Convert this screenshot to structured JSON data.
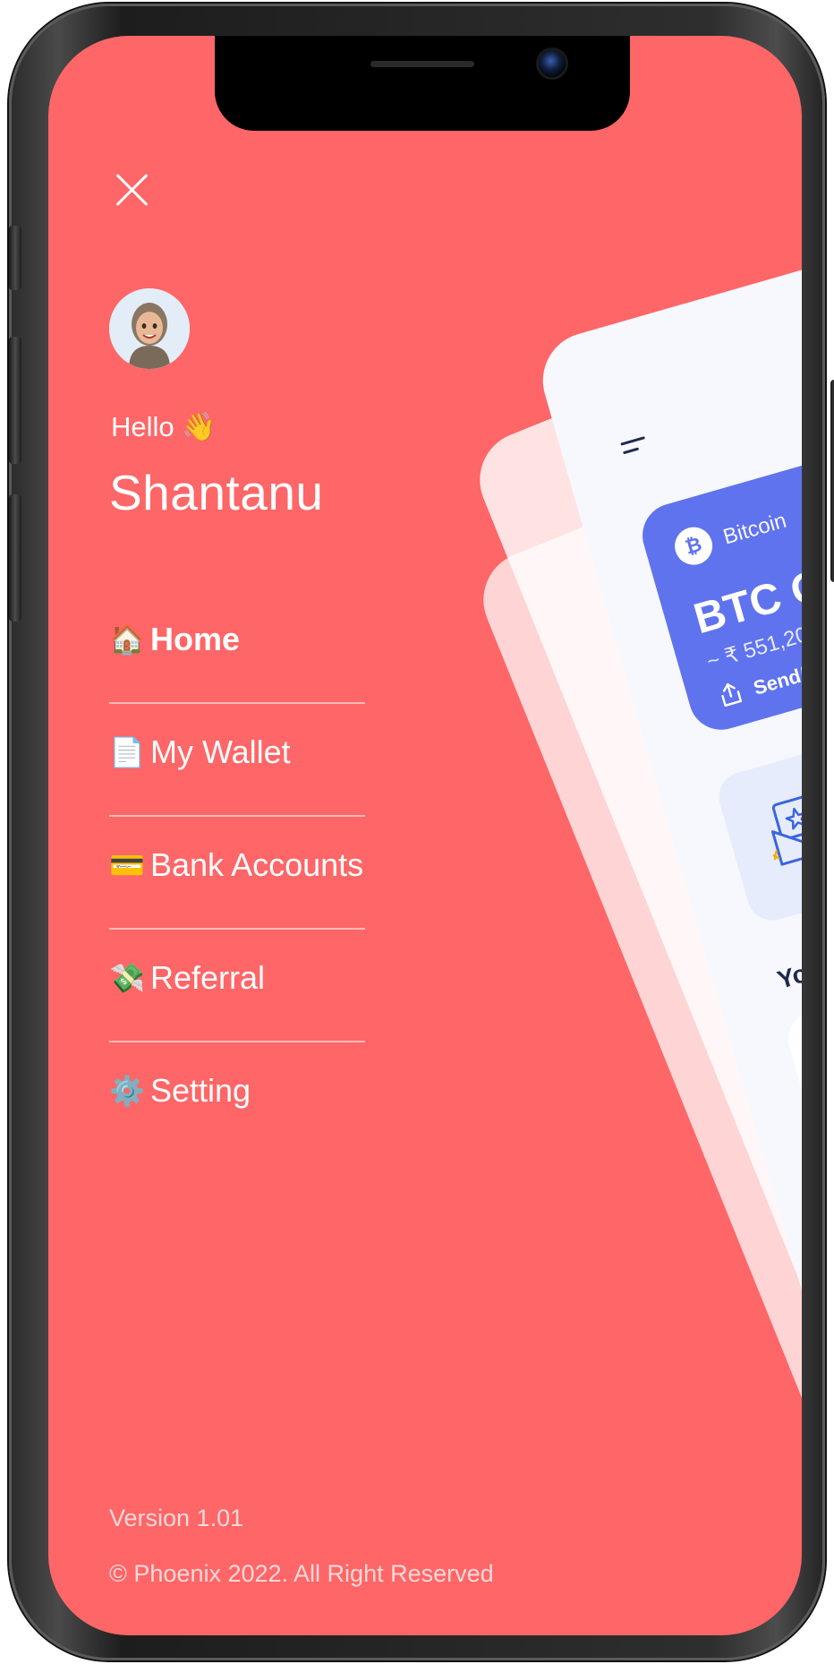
{
  "drawer": {
    "greeting": "Hello 👋",
    "user_name": "Shantanu",
    "menu": [
      {
        "icon": "🏠",
        "icon_name": "house-icon",
        "label": "Home",
        "active": true
      },
      {
        "icon": "📄",
        "icon_name": "document-icon",
        "label": "My Wallet",
        "active": false
      },
      {
        "icon": "💳",
        "icon_name": "credit-card-icon",
        "label": "Bank Accounts",
        "active": false
      },
      {
        "icon": "💸",
        "icon_name": "money-wings-icon",
        "label": "Referral",
        "active": false
      },
      {
        "icon": "⚙️",
        "icon_name": "gear-icon",
        "label": "Setting",
        "active": false
      }
    ],
    "version": "Version 1.01",
    "copyright": "© Phoenix 2022. All Right Reserved"
  },
  "preview": {
    "wallet_card": {
      "coin_symbol": "₿",
      "coin_name": "Bitcoin",
      "balance": "BTC O",
      "inr_value": "~ ₹ 551,20",
      "action": "Send/"
    },
    "section_title": "Your"
  },
  "colors": {
    "drawer_background": "#fe6667",
    "card_accent": "#5f73ee",
    "text_on_drawer": "#ffffff",
    "preview_background": "#f6f8fd"
  }
}
